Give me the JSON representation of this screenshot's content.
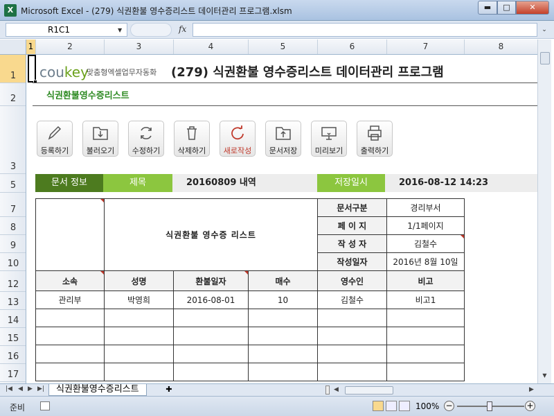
{
  "window": {
    "title": "Microsoft Excel - (279) 식권환불 영수증리스트 데이터관리 프로그램.xlsm",
    "app_icon": "X",
    "minimize": "▬",
    "maximize": "□",
    "close": "✕"
  },
  "formula_bar": {
    "name_box": "R1C1",
    "fx": "fx",
    "formula": ""
  },
  "columns": [
    "1",
    "2",
    "3",
    "4",
    "5",
    "6",
    "7",
    "8"
  ],
  "rows": [
    "1",
    "2",
    "3",
    "5",
    "7",
    "8",
    "9",
    "10",
    "12",
    "13",
    "14",
    "15",
    "16",
    "17"
  ],
  "header": {
    "logo_main": "cou",
    "logo_key": "key",
    "logo_sub": "맞춤형엑셀업무자동화",
    "title": "(279) 식권환불 영수증리스트 데이터관리 프로그램",
    "subtitle": "식권환불영수증리스트"
  },
  "toolbar": [
    {
      "label": "등록하기",
      "icon": "pencil-icon"
    },
    {
      "label": "불러오기",
      "icon": "open-folder-icon"
    },
    {
      "label": "수정하기",
      "icon": "refresh-icon"
    },
    {
      "label": "삭제하기",
      "icon": "trash-icon"
    },
    {
      "label": "새로작성",
      "icon": "new-icon"
    },
    {
      "label": "문서저장",
      "icon": "save-folder-icon"
    },
    {
      "label": "미리보기",
      "icon": "preview-icon"
    },
    {
      "label": "출력하기",
      "icon": "printer-icon"
    }
  ],
  "info_bar": {
    "doc_info": "문서 정보",
    "title_label": "제목",
    "title_value": "20160809 내역",
    "save_label": "저장일시",
    "save_value": "2016-08-12 14:23"
  },
  "form": {
    "big_title": "식권환불 영수증 리스트",
    "meta": [
      {
        "label": "문서구분",
        "value": "경리부서"
      },
      {
        "label": "페 이 지",
        "value": "1/1페이지"
      },
      {
        "label": "작 성 자",
        "value": "김철수"
      },
      {
        "label": "작성일자",
        "value": "2016년 8월 10일"
      }
    ],
    "columns": [
      "소속",
      "성명",
      "환불일자",
      "매수",
      "영수인",
      "비고"
    ],
    "rows": [
      [
        "관리부",
        "박영희",
        "2016-08-01",
        "10",
        "김철수",
        "비고1"
      ]
    ]
  },
  "sheet_tabs": [
    "식권환불영수증리스트"
  ],
  "status": {
    "ready": "준비",
    "zoom": "100%",
    "zoom_minus": "−",
    "zoom_plus": "+"
  }
}
